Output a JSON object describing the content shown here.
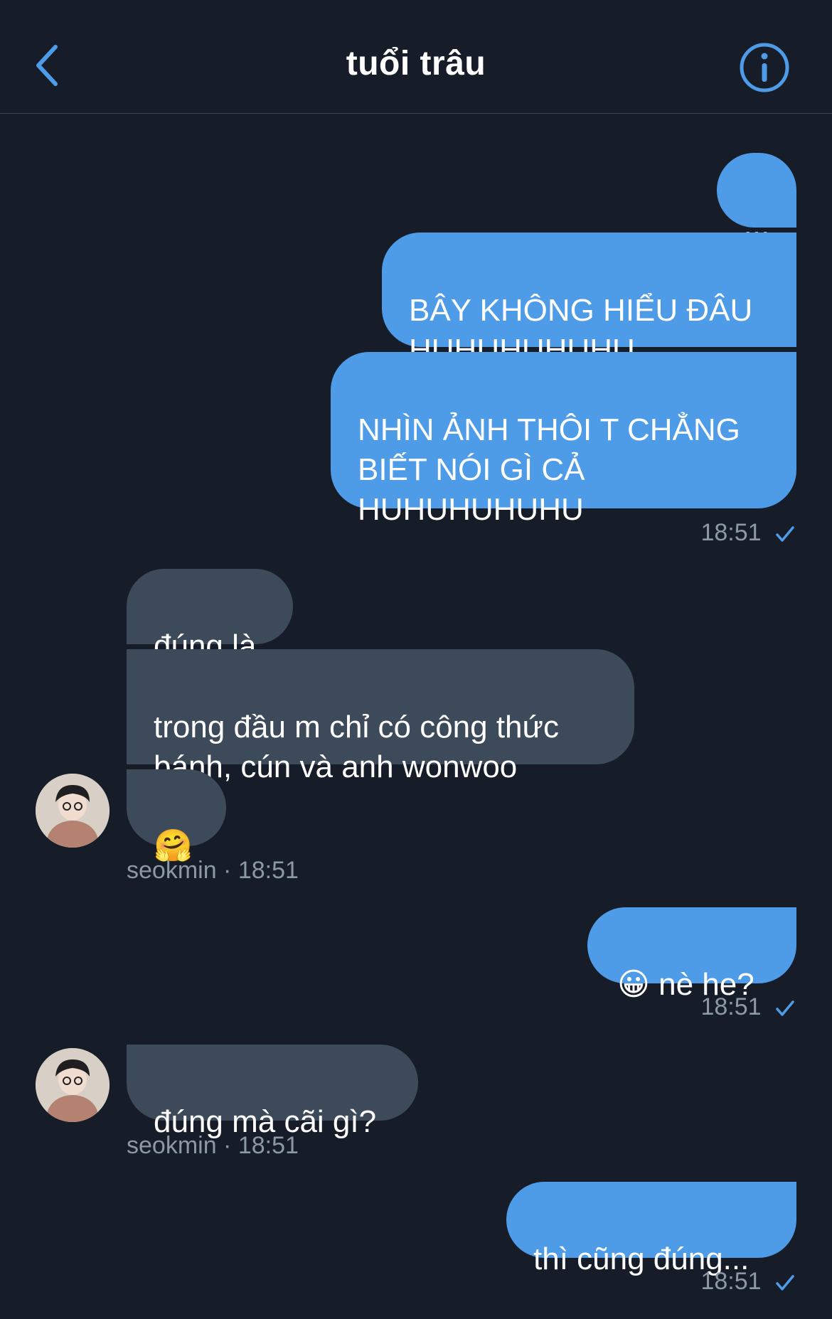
{
  "header": {
    "title": "tuổi trâu"
  },
  "messages": [
    {
      "text": "..."
    },
    {
      "text": "BÂY KHÔNG HIỂU ĐÂU\nHUHUHUHUHU"
    },
    {
      "text": "NHÌN ẢNH THÔI T CHẲNG\nBIẾT NÓI GÌ CẢ\nHUHUHUHUHU"
    },
    {
      "text": "đúng là"
    },
    {
      "text": "trong đầu m chỉ có công thức\nbánh, cún và anh wonwoo"
    },
    {
      "text": "🤗"
    },
    {
      "text": "😀 nè he?"
    },
    {
      "text": "đúng mà cãi gì?"
    },
    {
      "text": "thì cũng đúng..."
    }
  ],
  "meta": {
    "time_1": "18:51",
    "sender_1": "seokmin · 18:51",
    "time_2": "18:51",
    "sender_2": "seokmin · 18:51",
    "time_3": "18:51"
  },
  "colors": {
    "background": "#161d29",
    "outgoing_bubble": "#4e9be8",
    "incoming_bubble": "#3c4a5a",
    "accent": "#4e9be8",
    "meta_text": "#8b98a5"
  },
  "icons": {
    "back": "chevron-left-icon",
    "info": "info-circle-icon",
    "read_receipt": "checkmark-icon"
  }
}
